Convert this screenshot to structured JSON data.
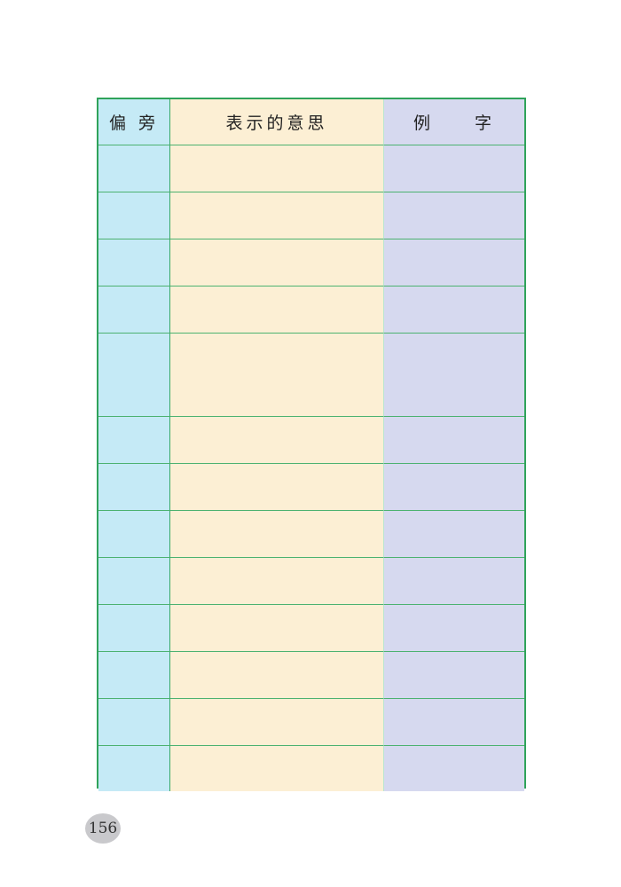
{
  "table": {
    "headers": {
      "radical": "偏 旁",
      "meaning": "表示的意思",
      "example": "例　　字"
    },
    "rows": [
      [
        "",
        "",
        ""
      ],
      [
        "",
        "",
        ""
      ],
      [
        "",
        "",
        ""
      ],
      [
        "",
        "",
        ""
      ],
      [
        "",
        "",
        ""
      ],
      [
        "",
        "",
        ""
      ],
      [
        "",
        "",
        ""
      ],
      [
        "",
        "",
        ""
      ],
      [
        "",
        "",
        ""
      ],
      [
        "",
        "",
        ""
      ],
      [
        "",
        "",
        ""
      ],
      [
        "",
        "",
        ""
      ],
      [
        "",
        "",
        ""
      ]
    ]
  },
  "page": {
    "number": "156"
  }
}
